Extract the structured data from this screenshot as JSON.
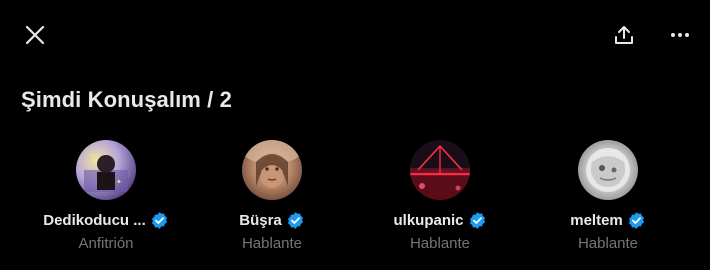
{
  "space": {
    "title": "Şimdi Konuşalım / 2"
  },
  "participants": [
    {
      "name": "Dedikoducu ...",
      "role": "Anfitrión",
      "verified": true
    },
    {
      "name": "Büşra",
      "role": "Hablante",
      "verified": true
    },
    {
      "name": "ulkupanic",
      "role": "Hablante",
      "verified": true
    },
    {
      "name": "meltem",
      "role": "Hablante",
      "verified": true
    }
  ],
  "icons": {
    "close": "close-icon",
    "share": "share-icon",
    "more": "more-icon",
    "verified": "verified-badge-icon"
  },
  "colors": {
    "background": "#000000",
    "text_primary": "#e7e9ea",
    "text_secondary": "#71767b",
    "verified_blue": "#1d9bf0"
  }
}
